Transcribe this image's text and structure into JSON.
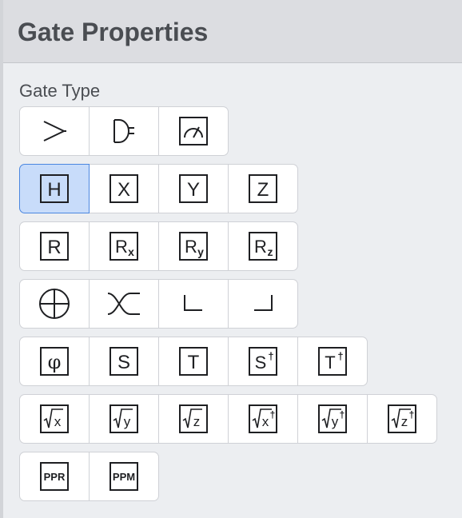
{
  "header": {
    "title": "Gate Properties"
  },
  "gate_type": {
    "label": "Gate Type",
    "selected": "H",
    "rows": [
      [
        {
          "name": "control-icon"
        },
        {
          "name": "and-gate-icon"
        },
        {
          "name": "measure-icon"
        }
      ],
      [
        {
          "name": "h-gate",
          "text": "H"
        },
        {
          "name": "x-gate",
          "text": "X"
        },
        {
          "name": "y-gate",
          "text": "Y"
        },
        {
          "name": "z-gate",
          "text": "Z"
        }
      ],
      [
        {
          "name": "r-gate",
          "text": "R"
        },
        {
          "name": "rx-gate",
          "text": "R",
          "sub": "x"
        },
        {
          "name": "ry-gate",
          "text": "R",
          "sub": "y"
        },
        {
          "name": "rz-gate",
          "text": "R",
          "sub": "z"
        }
      ],
      [
        {
          "name": "oplus-icon"
        },
        {
          "name": "swap-icon"
        },
        {
          "name": "corner-left-icon"
        },
        {
          "name": "corner-right-icon"
        }
      ],
      [
        {
          "name": "phi-gate",
          "text": "φ"
        },
        {
          "name": "s-gate",
          "text": "S"
        },
        {
          "name": "t-gate",
          "text": "T"
        },
        {
          "name": "s-dagger-gate",
          "text": "S",
          "sup": "†"
        },
        {
          "name": "t-dagger-gate",
          "text": "T",
          "sup": "†"
        }
      ],
      [
        {
          "name": "sqrt-x-gate",
          "text": "x"
        },
        {
          "name": "sqrt-y-gate",
          "text": "y"
        },
        {
          "name": "sqrt-z-gate",
          "text": "z"
        },
        {
          "name": "sqrt-x-dagger-gate",
          "text": "x",
          "sup": "†"
        },
        {
          "name": "sqrt-y-dagger-gate",
          "text": "y",
          "sup": "†"
        },
        {
          "name": "sqrt-z-dagger-gate",
          "text": "z",
          "sup": "†"
        }
      ],
      [
        {
          "name": "ppr-gate",
          "text": "PPR"
        },
        {
          "name": "ppm-gate",
          "text": "PPM"
        }
      ]
    ]
  }
}
